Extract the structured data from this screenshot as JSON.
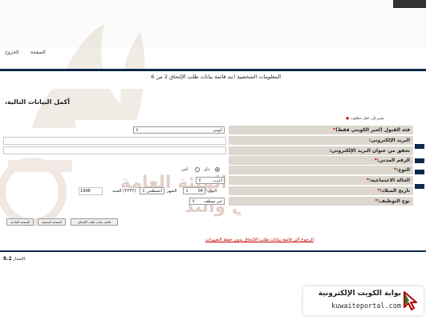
{
  "top": {
    "home_link": "الصفحة",
    "logout_link": "الخروج"
  },
  "watermark": {
    "line1": "الهيئة العامة",
    "line2": "لتعليم التطبيقي والتد"
  },
  "section_title": "المعلومات الشخصية (بند قائمة بيانات طلب الإلتحاق 2 من 6",
  "form_title": "أكمل البيانات التالية،",
  "required_note": "يشير إلى حقل مطلوب",
  "fields": {
    "category": {
      "label": "فئة القبول (لغير الكويتي فقط)",
      "value": "كويتي"
    },
    "email": {
      "label": "البريد الإلكتروني:"
    },
    "email_confirm": {
      "label": "تحقق من عنوان البريد الإلكتروني:"
    },
    "civil_id": {
      "label": "الرقم المدني:"
    },
    "gender": {
      "label": "النوع:",
      "male": "ذكر",
      "female": "أنثى"
    },
    "marital": {
      "label": "الحالة الاجتماعية:",
      "value": "أعزب"
    },
    "birthdate": {
      "label": "تاريخ الميلاد:",
      "day_label": "اليوم",
      "day_value": "04",
      "month_label": "الشهر",
      "month_value": "أغسطس",
      "year_label": "السنة",
      "year_value": "(YYYY)",
      "year_extra": "1998"
    },
    "employment": {
      "label": "نوع التوظيف:",
      "value": "غير موظف"
    }
  },
  "buttons": {
    "next": "الصفحة القادمة",
    "prev": "الصفحة السابقة",
    "list": "قائمة بيانات طلب الإلتحاق"
  },
  "back_link": "الرجوع الى قائمة بيانات طلب الإلتحاق بدون حفظ التغييرات",
  "version": {
    "label": "الإصدار:",
    "value": "8.2"
  },
  "logo": {
    "arabic": "بوابة الكويت الإلكترونية",
    "english": "kuwaiteportal.com"
  },
  "colors": {
    "nav": "#0e2a4a",
    "label_bg": "#dcd8d0",
    "required": "#cc0000",
    "link": "#c00000"
  },
  "icons": {
    "select_arrow": "chevron-updown-icon",
    "logo": "cursor-arrow-icon"
  }
}
